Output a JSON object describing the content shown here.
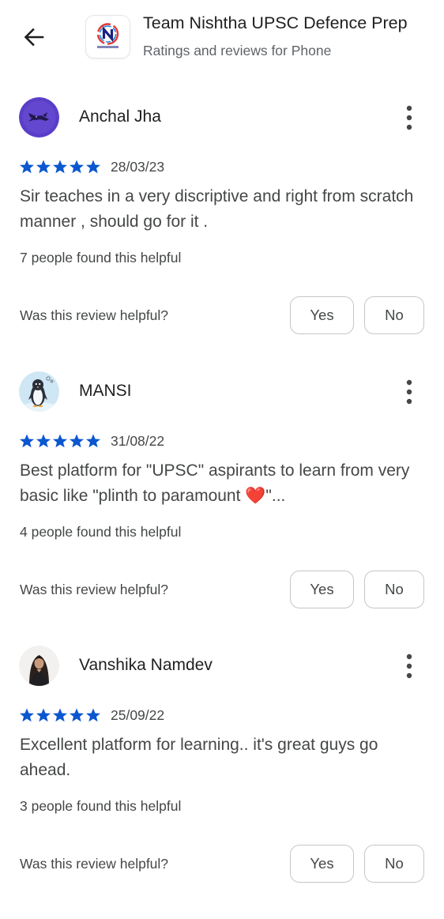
{
  "header": {
    "back_icon": "arrow-back-icon",
    "app_icon": "nishtha-logo",
    "app_icon_tiny_text": "TEAM NISHTHA",
    "title": "Team Nishtha UPSC Defence Prep",
    "subtitle": "Ratings and reviews for Phone"
  },
  "colors": {
    "star": "#0b57d0",
    "text_primary": "#1f1f1f",
    "text_secondary": "#444746",
    "button_border": "#c4c7c5"
  },
  "reviews": [
    {
      "name": "Anchal Jha",
      "avatar": "purple-avatar-with-dragon",
      "rating": 5,
      "date": "28/03/23",
      "text": "Sir teaches in a very discriptive and right from scratch manner , should go for it .",
      "helpful_count": "7 people found this helpful",
      "helpful_question": "Was this review helpful?",
      "yes_label": "Yes",
      "no_label": "No"
    },
    {
      "name": "MANSI",
      "avatar": "penguin-avatar",
      "rating": 5,
      "date": "31/08/22",
      "text": "Best platform for \"UPSC\" aspirants to learn from very basic like \"plinth to paramount ❤️\"...",
      "helpful_count": "4 people found this helpful",
      "helpful_question": "Was this review helpful?",
      "yes_label": "Yes",
      "no_label": "No"
    },
    {
      "name": "Vanshika Namdev",
      "avatar": "photo-avatar",
      "rating": 5,
      "date": "25/09/22",
      "text": "Excellent platform for learning.. it's great guys go ahead.",
      "helpful_count": "3 people found this helpful",
      "helpful_question": "Was this review helpful?",
      "yes_label": "Yes",
      "no_label": "No"
    }
  ]
}
